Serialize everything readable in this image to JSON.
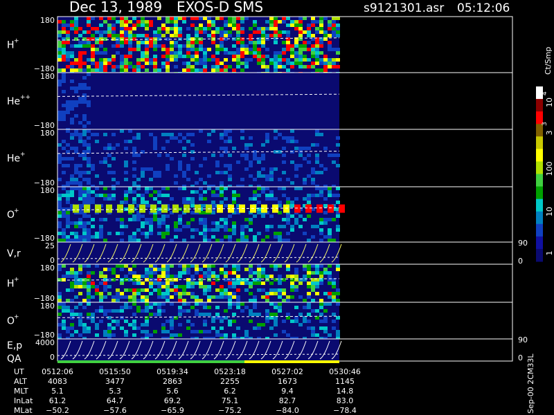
{
  "header": {
    "date": "Dec 13, 1989",
    "instrument": "EXOS-D SMS",
    "file": "s9121301.asr",
    "time": "05:12:06"
  },
  "chart_data": {
    "type": "heatmap",
    "panels": [
      {
        "id": "h_plus",
        "ion": "H",
        "charge": "+",
        "ymax": "180",
        "ymin": "−180"
      },
      {
        "id": "he_pp",
        "ion": "He",
        "charge": "++",
        "ymax": "180",
        "ymin": "−180"
      },
      {
        "id": "he_plus",
        "ion": "He",
        "charge": "+",
        "ymax": "180",
        "ymin": "−180"
      },
      {
        "id": "o_plus",
        "ion": "O",
        "charge": "+",
        "ymax": "180",
        "ymin": "−180"
      },
      {
        "id": "vr",
        "label": "V,r",
        "ymax": "25",
        "ymin": "0",
        "right_top": "90",
        "right_bottom": "0"
      },
      {
        "id": "h_plus2",
        "ion": "H",
        "charge": "+",
        "ymax": "180",
        "ymin": "−180"
      },
      {
        "id": "o_plus2",
        "ion": "O",
        "charge": "+",
        "ymax": "180",
        "ymin": "−180"
      },
      {
        "id": "ep",
        "label": "E,p",
        "label2": "QA",
        "ymax": "4000",
        "ymin": "0",
        "right_top": "90",
        "right_bottom": "0"
      }
    ],
    "colorbar": {
      "unit": "Ct/Smp",
      "ticks": [
        "10",
        "3",
        "100",
        "10",
        "1"
      ],
      "tick_exponents": [
        "4",
        "3",
        "",
        "",
        ""
      ],
      "colors": [
        "#ffffff",
        "#8b0000",
        "#ff0000",
        "#806000",
        "#c8c800",
        "#ffff00",
        "#b0e000",
        "#40d040",
        "#00a000",
        "#00c8c8",
        "#0080c0",
        "#1040c0",
        "#1010a0",
        "#0a0a70"
      ]
    },
    "timeline": {
      "rows": [
        {
          "label": "UT",
          "values": [
            "0512:06",
            "0515:50",
            "0519:34",
            "0523:18",
            "0527:02",
            "0530:46"
          ]
        },
        {
          "label": "ALT",
          "values": [
            "4083",
            "3477",
            "2863",
            "2255",
            "1673",
            "1145"
          ]
        },
        {
          "label": "MLT",
          "values": [
            "5.1",
            "5.3",
            "5.6",
            "6.2",
            "9.4",
            "14.8"
          ]
        },
        {
          "label": "InLat",
          "values": [
            "61.2",
            "64.7",
            "69.2",
            "75.1",
            "82.7",
            "83.0"
          ]
        },
        {
          "label": "MLat",
          "values": [
            "−50.2",
            "−57.6",
            "−65.9",
            "−75.2",
            "−84.0",
            "−78.4"
          ]
        }
      ]
    }
  },
  "footer": {
    "stamp": "Sep-00 2CM33L"
  }
}
